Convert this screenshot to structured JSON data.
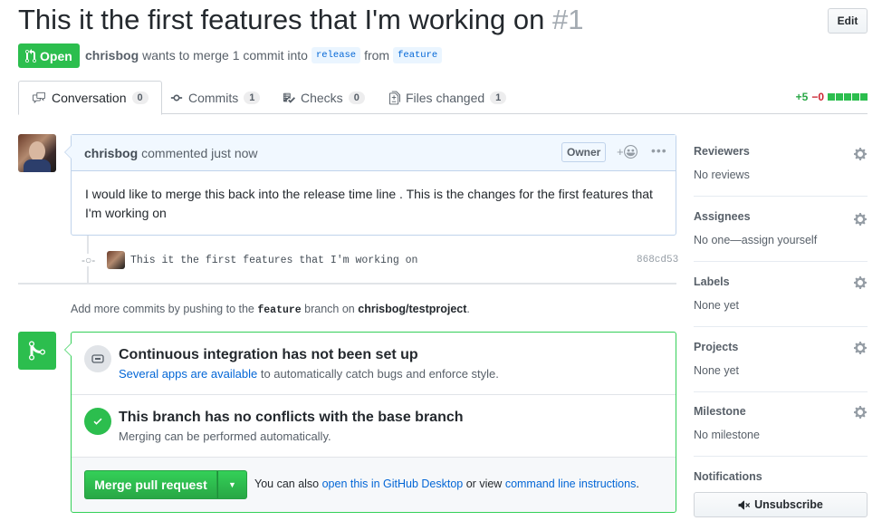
{
  "header": {
    "title": "This it the first features that I'm working on",
    "number": "#1",
    "edit_label": "Edit"
  },
  "state": {
    "label": "Open",
    "author": "chrisbog",
    "text_before": "wants to merge 1 commit into",
    "base_branch": "release",
    "text_mid": "from",
    "head_branch": "feature"
  },
  "tabs": [
    {
      "label": "Conversation",
      "count": "0",
      "icon": "comment-discussion-icon",
      "selected": true
    },
    {
      "label": "Commits",
      "count": "1",
      "icon": "git-commit-icon"
    },
    {
      "label": "Checks",
      "count": "0",
      "icon": "checklist-icon"
    },
    {
      "label": "Files changed",
      "count": "1",
      "icon": "file-diff-icon"
    }
  ],
  "diffstat": {
    "additions": "+5",
    "deletions": "−0"
  },
  "comment": {
    "author": "chrisbog",
    "action": "commented just now",
    "badge": "Owner",
    "body": "I would like to merge this back into the release time line . This is the changes for the first features that I'm working on"
  },
  "commit": {
    "message": "This it the first features that I'm working on",
    "sha": "868cd53"
  },
  "hint": {
    "prefix": "Add more commits by pushing to the",
    "branch": "feature",
    "middle": "branch on",
    "repo": "chrisbog/testproject",
    "suffix": "."
  },
  "mergebox": {
    "ci_title": "Continuous integration has not been set up",
    "ci_link": "Several apps are available",
    "ci_rest": "to automatically catch bugs and enforce style.",
    "conflict_title": "This branch has no conflicts with the base branch",
    "conflict_sub": "Merging can be performed automatically.",
    "merge_button": "Merge pull request",
    "footer_prefix": "You can also",
    "footer_link1": "open this in GitHub Desktop",
    "footer_mid": "or view",
    "footer_link2": "command line instructions",
    "footer_suffix": "."
  },
  "sidebar": {
    "reviewers": {
      "title": "Reviewers",
      "value": "No reviews"
    },
    "assignees": {
      "title": "Assignees",
      "value": "No one—assign yourself"
    },
    "labels": {
      "title": "Labels",
      "value": "None yet"
    },
    "projects": {
      "title": "Projects",
      "value": "None yet"
    },
    "milestone": {
      "title": "Milestone",
      "value": "No milestone"
    },
    "notifications": {
      "title": "Notifications",
      "button": "Unsubscribe"
    }
  },
  "colors": {
    "accent_green": "#2cbe4e",
    "link_blue": "#0366d6",
    "deletion_red": "#cb2431"
  }
}
